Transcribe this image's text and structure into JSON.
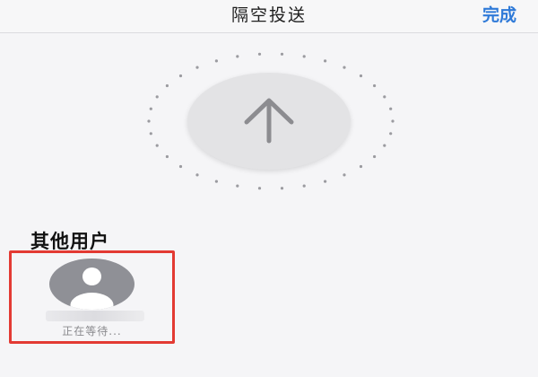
{
  "navbar": {
    "title": "隔空投送",
    "done_label": "完成"
  },
  "upload": {
    "icon": "arrow-up-icon"
  },
  "section": {
    "title": "其他用户"
  },
  "user": {
    "avatar_icon": "person-icon",
    "name": "",
    "status": "正在等待..."
  },
  "colors": {
    "accent": "#2f7ad8",
    "highlight_border": "#e33a33",
    "avatar_bg": "#8f9096"
  }
}
